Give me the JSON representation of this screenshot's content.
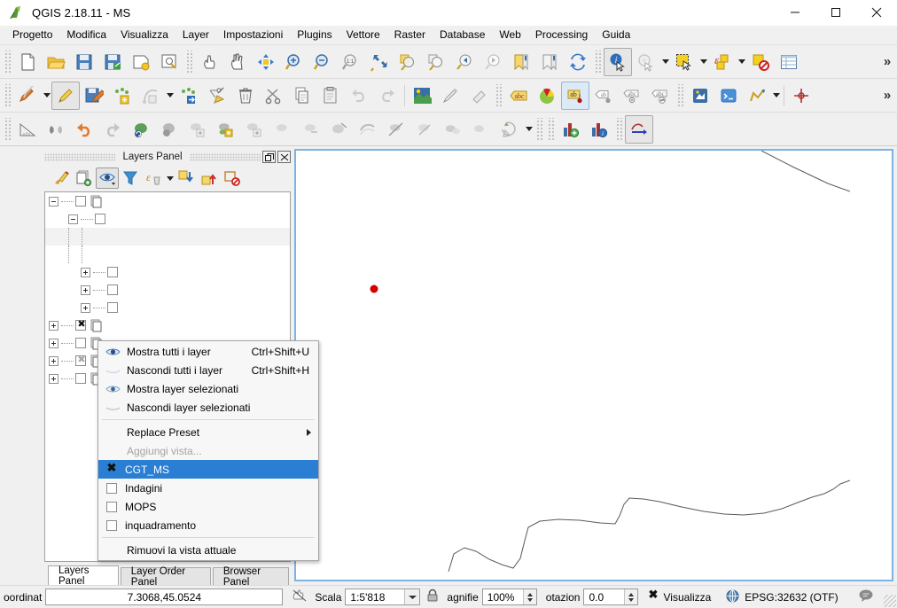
{
  "window": {
    "title": "QGIS 2.18.11 - MS",
    "app_icon": "qgis-logo-icon",
    "minimize_label": "—",
    "maximize_label": "□",
    "close_label": "✕"
  },
  "menubar": {
    "items": [
      {
        "label": "Progetto"
      },
      {
        "label": "Modifica"
      },
      {
        "label": "Visualizza"
      },
      {
        "label": "Layer"
      },
      {
        "label": "Impostazioni"
      },
      {
        "label": "Plugins"
      },
      {
        "label": "Vettore"
      },
      {
        "label": "Raster"
      },
      {
        "label": "Database"
      },
      {
        "label": "Web"
      },
      {
        "label": "Processing"
      },
      {
        "label": "Guida"
      }
    ]
  },
  "toolbars": {
    "overflow_label": "»",
    "row1": [
      "new-project-icon",
      "open-project-icon",
      "save-project-icon",
      "save-project-as-icon",
      "new-print-composer-icon",
      "composer-manager-icon",
      "touch-zoom-pan-icon",
      "pan-map-icon",
      "pan-to-selection-icon",
      "zoom-in-icon",
      "zoom-out-icon",
      "zoom-full-icon",
      "zoom-native-icon",
      "zoom-last-icon",
      "zoom-to-selection-icon",
      "zoom-to-layer-icon",
      "zoom-previous-icon",
      "zoom-next-icon",
      "new-bookmark-icon",
      "show-bookmarks-icon",
      "refresh-icon",
      "identify-features-icon",
      "map-tips-icon",
      "select-features-icon",
      "deselect-features-icon",
      "select-by-expression-icon",
      "deselect-all-icon",
      "open-attribute-table-icon"
    ],
    "row2": [
      "current-edits-icon",
      "toggle-editing-icon",
      "save-layer-edits-icon",
      "add-feature-icon",
      "add-circular-string-icon",
      "move-feature-icon",
      "node-tool-icon",
      "delete-selected-icon",
      "cut-features-icon",
      "copy-features-icon",
      "paste-features-icon",
      "undo-edit-icon",
      "redo-edit-icon",
      "raster-calculator-icon",
      "pencil-icon",
      "eraser-icon",
      "label-abc-icon",
      "diagram-icon",
      "pin-labels-icon",
      "show-hide-labels-icon",
      "move-label-icon",
      "rotate-label-icon",
      "change-label-icon",
      "style-manager-icon",
      "python-console-icon",
      "georeferencer-icon"
    ],
    "row3": [
      "measure-line-icon",
      "snapping-options-icon",
      "undo-icon",
      "redo-icon",
      "rotate-feature-icon",
      "simplify-feature-icon",
      "add-ring-icon",
      "add-part-icon",
      "fill-ring-icon",
      "delete-ring-icon",
      "delete-part-icon",
      "reshape-features-icon",
      "offset-curve-icon",
      "split-features-icon",
      "split-parts-icon",
      "merge-features-icon",
      "merge-attributes-icon",
      "rotate-point-symbols-icon",
      "offset-point-symbol-icon",
      "new-mesh-layer-icon",
      "statistics-icon",
      "arrow-tool-icon"
    ]
  },
  "layers_panel": {
    "title": "Layers Panel",
    "float_button": "restore-panel-icon",
    "close_button": "close-panel-icon",
    "toolbar": [
      "style-manager-icon",
      "add-group-icon",
      "manage-layer-visibility-icon",
      "filter-legend-icon",
      "filter-legend-expression-icon",
      "expand-all-icon",
      "collapse-all-icon",
      "remove-layer-icon"
    ],
    "tree": [
      {
        "expander": "minus",
        "indent": 0,
        "checkbox": "unchecked",
        "icon": "group-icon"
      },
      {
        "expander": "minus",
        "indent": 1,
        "checkbox": "unchecked",
        "icon": "none"
      },
      {
        "expander": "none",
        "indent": 2,
        "checkbox": "none",
        "icon": "none"
      },
      {
        "expander": "none",
        "indent": 2,
        "checkbox": "none",
        "icon": "none"
      },
      {
        "expander": "plus",
        "indent": 1,
        "checkbox": "unchecked",
        "icon": "none"
      },
      {
        "expander": "plus",
        "indent": 1,
        "checkbox": "unchecked",
        "icon": "none"
      },
      {
        "expander": "plus",
        "indent": 1,
        "checkbox": "unchecked",
        "icon": "none"
      },
      {
        "expander": "plus",
        "indent": 0,
        "checkbox": "checked",
        "icon": "group-icon"
      },
      {
        "expander": "plus",
        "indent": 0,
        "checkbox": "unchecked",
        "icon": "group-icon"
      },
      {
        "expander": "plus",
        "indent": 0,
        "checkbox": "dimmed",
        "icon": "group-icon"
      },
      {
        "expander": "plus",
        "indent": 0,
        "checkbox": "unchecked",
        "icon": "group-icon"
      }
    ],
    "tabs": [
      {
        "label": "Layers Panel",
        "active": true
      },
      {
        "label": "Layer Order Panel",
        "active": false
      },
      {
        "label": "Browser Panel",
        "active": false
      }
    ]
  },
  "visibility_menu": {
    "items": [
      {
        "kind": "action",
        "icon": "show-all-layers-icon",
        "label": "Mostra tutti i layer",
        "shortcut": "Ctrl+Shift+U"
      },
      {
        "kind": "action",
        "icon": "hide-all-layers-icon",
        "label": "Nascondi tutti i layer",
        "shortcut": "Ctrl+Shift+H"
      },
      {
        "kind": "action",
        "icon": "show-selected-layers-icon",
        "label": "Mostra layer selezionati",
        "shortcut": ""
      },
      {
        "kind": "action",
        "icon": "hide-selected-layers-icon",
        "label": "Nascondi layer selezionati",
        "shortcut": ""
      },
      {
        "kind": "separator"
      },
      {
        "kind": "submenu",
        "icon": "none",
        "label": "Replace Preset",
        "shortcut": ""
      },
      {
        "kind": "disabled",
        "icon": "none",
        "label": "Aggiungi vista...",
        "shortcut": ""
      },
      {
        "kind": "check",
        "checked": true,
        "selected": true,
        "label": "CGT_MS",
        "shortcut": ""
      },
      {
        "kind": "check",
        "checked": false,
        "selected": false,
        "label": "Indagini",
        "shortcut": ""
      },
      {
        "kind": "check",
        "checked": false,
        "selected": false,
        "label": "MOPS",
        "shortcut": ""
      },
      {
        "kind": "check",
        "checked": false,
        "selected": false,
        "label": "inquadramento",
        "shortcut": ""
      },
      {
        "kind": "separator"
      },
      {
        "kind": "action",
        "icon": "none",
        "label": "Rimuovi la vista attuale",
        "shortcut": ""
      }
    ]
  },
  "map": {
    "point_color": "#d40000",
    "line_color": "#5a5a5a",
    "background": "#ffffff",
    "border_color": "#7eb2e0"
  },
  "statusbar": {
    "coordinate_label": "oordinat",
    "coordinate_value": "7.3068,45.0524",
    "toggle_extents_icon": "toggle-extents-icon",
    "scale_label": "Scala",
    "scale_value": "1:5'818",
    "lock_icon": "lock-scale-icon",
    "magnifier_label": "agnifie",
    "magnifier_value": "100%",
    "rotation_label": "otazion",
    "rotation_value": "0.0",
    "render_label": "Visualizza",
    "render_checked": true,
    "crs_icon": "crs-globe-icon",
    "crs_label": "EPSG:32632 (OTF)",
    "messages_icon": "messages-log-icon"
  }
}
